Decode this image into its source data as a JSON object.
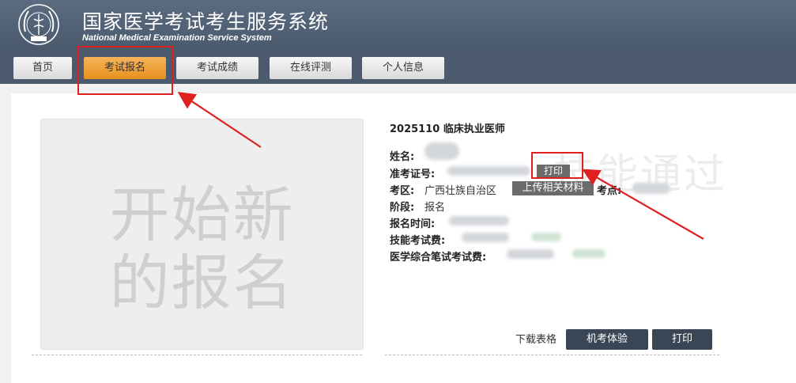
{
  "header": {
    "title_cn": "国家医学考试考生服务系统",
    "title_en": "National Medical Examination Service System"
  },
  "nav": {
    "tabs": [
      {
        "label": "首页",
        "active": false
      },
      {
        "label": "考试报名",
        "active": true
      },
      {
        "label": "考试成绩",
        "active": false
      },
      {
        "label": "在线评测",
        "active": false
      },
      {
        "label": "个人信息",
        "active": false
      }
    ]
  },
  "new_registration": {
    "line1": "开始新",
    "line2": "的报名"
  },
  "watermark": "技能通过",
  "exam": {
    "title": "2025110 临床执业医师",
    "fields": {
      "name_label": "姓名:",
      "ticket_label": "准考证号:",
      "region_label": "考区:",
      "region_value": "广西壮族自治区",
      "site_label": "考点:",
      "stage_label": "阶段:",
      "stage_value": "报名",
      "time_label": "报名时间:",
      "skill_fee_label": "技能考试费:",
      "written_fee_label": "医学综合笔试考试费:"
    },
    "buttons": {
      "print_small": "打印",
      "upload": "上传相关材料",
      "download": "下载表格",
      "computer_test": "机考体验",
      "print": "打印"
    }
  },
  "colors": {
    "header_bg": "#4f5e72",
    "active_tab": "#f0a340",
    "annotation_red": "#e02020",
    "dark_button": "#3a4656"
  }
}
